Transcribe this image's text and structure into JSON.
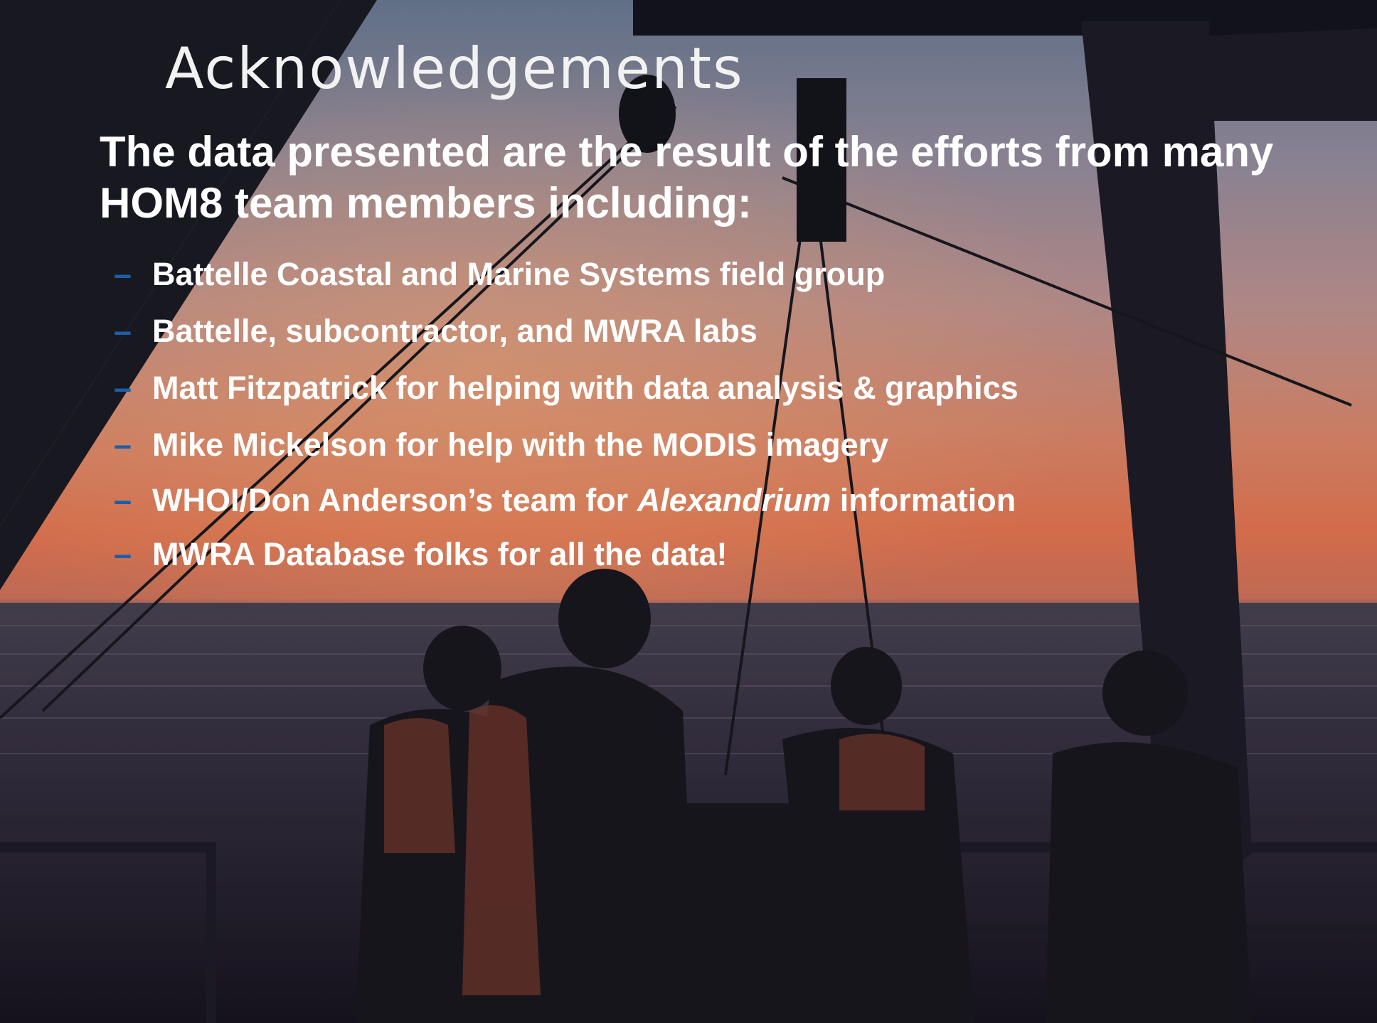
{
  "slide": {
    "title": "Acknowledgements",
    "lead": "The data presented are the result of the efforts from many HOM8 team members including:",
    "bullets": [
      {
        "text": "Battelle Coastal and Marine Systems field group"
      },
      {
        "text": "Battelle, subcontractor, and MWRA labs"
      },
      {
        "text": "Matt Fitzpatrick for helping with data analysis & graphics"
      },
      {
        "text": "Mike Mickelson for help with the MODIS imagery"
      },
      {
        "before": "WHOI/Don Anderson’s team for ",
        "italic": "Alexandrium",
        "after": " information"
      },
      {
        "text": "MWRA Database folks for all the data!"
      }
    ],
    "bullet_marker": "–",
    "colors": {
      "title": "#f2f2f2",
      "text": "#ffffff",
      "bullet_marker": "#1a5fa8"
    }
  },
  "background": {
    "description_icon": "sunset-deck-photo"
  }
}
